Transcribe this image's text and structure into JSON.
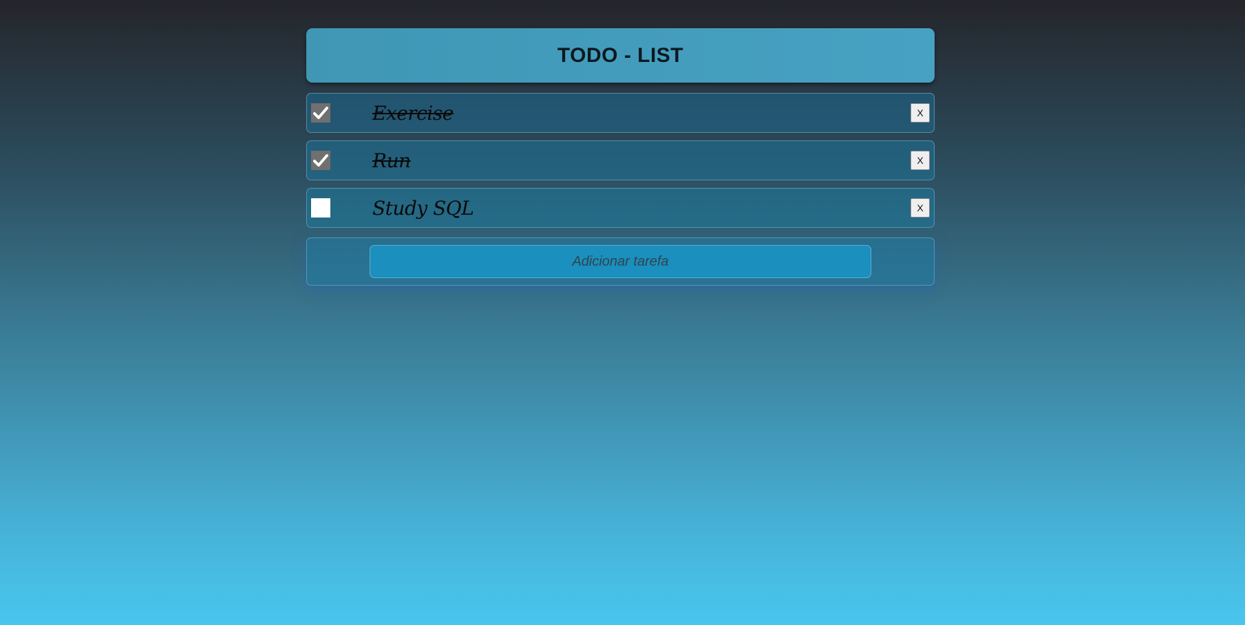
{
  "header": {
    "title": "TODO - LIST"
  },
  "tasks": [
    {
      "label": "Exercise",
      "done": true,
      "remove_label": "X"
    },
    {
      "label": "Run",
      "done": true,
      "remove_label": "X"
    },
    {
      "label": "Study SQL",
      "done": false,
      "remove_label": "X"
    }
  ],
  "add_task": {
    "placeholder": "Adicionar tarefa"
  },
  "icons": {
    "check": "checkmark-icon"
  },
  "colors": {
    "header_bg": "#43a0c0",
    "checkbox_checked": "#707070",
    "input_bg": "#1b8fbd"
  }
}
